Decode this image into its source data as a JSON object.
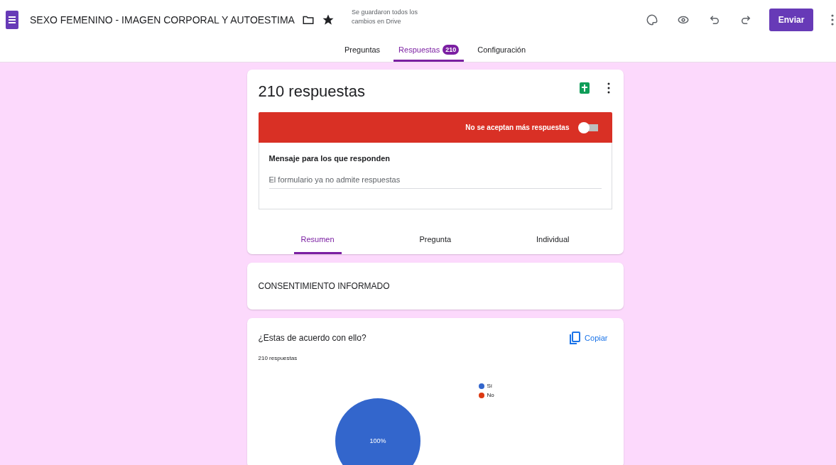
{
  "header": {
    "title": "SEXO FEMENINO - IMAGEN CORPORAL Y AUTOESTIMA",
    "save_status": "Se guardaron todos los cambios en Drive",
    "send_button": "Enviar"
  },
  "tabs": [
    {
      "label": "Preguntas",
      "selected": false
    },
    {
      "label": "Respuestas",
      "badge": "210",
      "selected": true
    },
    {
      "label": "Configuración",
      "selected": false
    }
  ],
  "summary": {
    "title": "210 respuestas",
    "accepting": {
      "label": "No se aceptan más respuestas",
      "on": false
    },
    "message_label": "Mensaje para los que responden",
    "message_value": "El formulario ya no admite respuestas",
    "view_tabs": [
      {
        "label": "Resumen",
        "selected": true
      },
      {
        "label": "Pregunta",
        "selected": false
      },
      {
        "label": "Individual",
        "selected": false
      }
    ]
  },
  "section": {
    "title": "CONSENTIMIENTO INFORMADO"
  },
  "question": {
    "title": "¿Estas de acuerdo con ello?",
    "copy_button": "Copiar",
    "count": "210 respuestas",
    "chart_data": {
      "type": "pie",
      "categories": [
        "Sí",
        "No"
      ],
      "values": [
        100,
        0
      ],
      "colors": [
        "#3366cc",
        "#dc3912"
      ],
      "value_labels": [
        "100%",
        null
      ]
    }
  }
}
